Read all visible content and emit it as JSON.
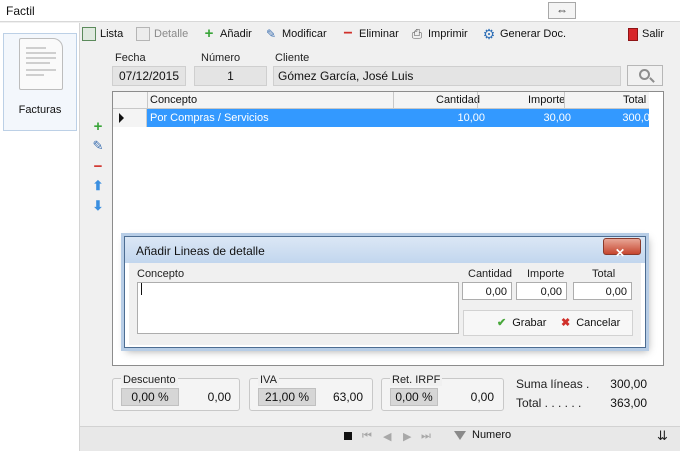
{
  "window": {
    "title": "Factil"
  },
  "sidebar": {
    "module_label": "Facturas"
  },
  "toolbar": {
    "lista": "Lista",
    "detalle": "Detalle",
    "anadir": "Añadir",
    "modificar": "Modificar",
    "eliminar": "Eliminar",
    "imprimir": "Imprimir",
    "generar": "Generar Doc.",
    "salir": "Salir"
  },
  "header": {
    "fecha_label": "Fecha",
    "fecha_value": "07/12/2015",
    "numero_label": "Número",
    "numero_value": "1",
    "cliente_label": "Cliente",
    "cliente_value": "Gómez García, José Luis"
  },
  "grid": {
    "columns": [
      "Concepto",
      "Cantidad",
      "Importe",
      "Total"
    ],
    "rows": [
      {
        "concepto": "Por Compras / Servicios",
        "cantidad": "10,00",
        "importe": "30,00",
        "total": "300,00"
      }
    ]
  },
  "dialog": {
    "title": "Añadir Lineas de detalle",
    "concepto_label": "Concepto",
    "concepto_value": "",
    "cantidad_label": "Cantidad",
    "cantidad_value": "0,00",
    "importe_label": "Importe",
    "importe_value": "0,00",
    "total_label": "Total",
    "total_value": "0,00",
    "grabar": "Grabar",
    "cancelar": "Cancelar"
  },
  "totals": {
    "descuento_label": "Descuento",
    "descuento_pct": "0,00 %",
    "descuento_amt": "0,00",
    "iva_label": "IVA",
    "iva_pct": "21,00 %",
    "iva_amt": "63,00",
    "irpf_label": "Ret. IRPF",
    "irpf_pct": "0,00 %",
    "irpf_amt": "0,00",
    "suma_label": "Suma líneas .",
    "suma_value": "300,00",
    "total_label": "Total . . . . . .",
    "total_value": "363,00"
  },
  "status": {
    "filter_label": "Numero"
  },
  "colors": {
    "accent": "#3399ff",
    "add": "#3aa53a",
    "delete": "#d0302a",
    "move": "#3b8fe0"
  }
}
